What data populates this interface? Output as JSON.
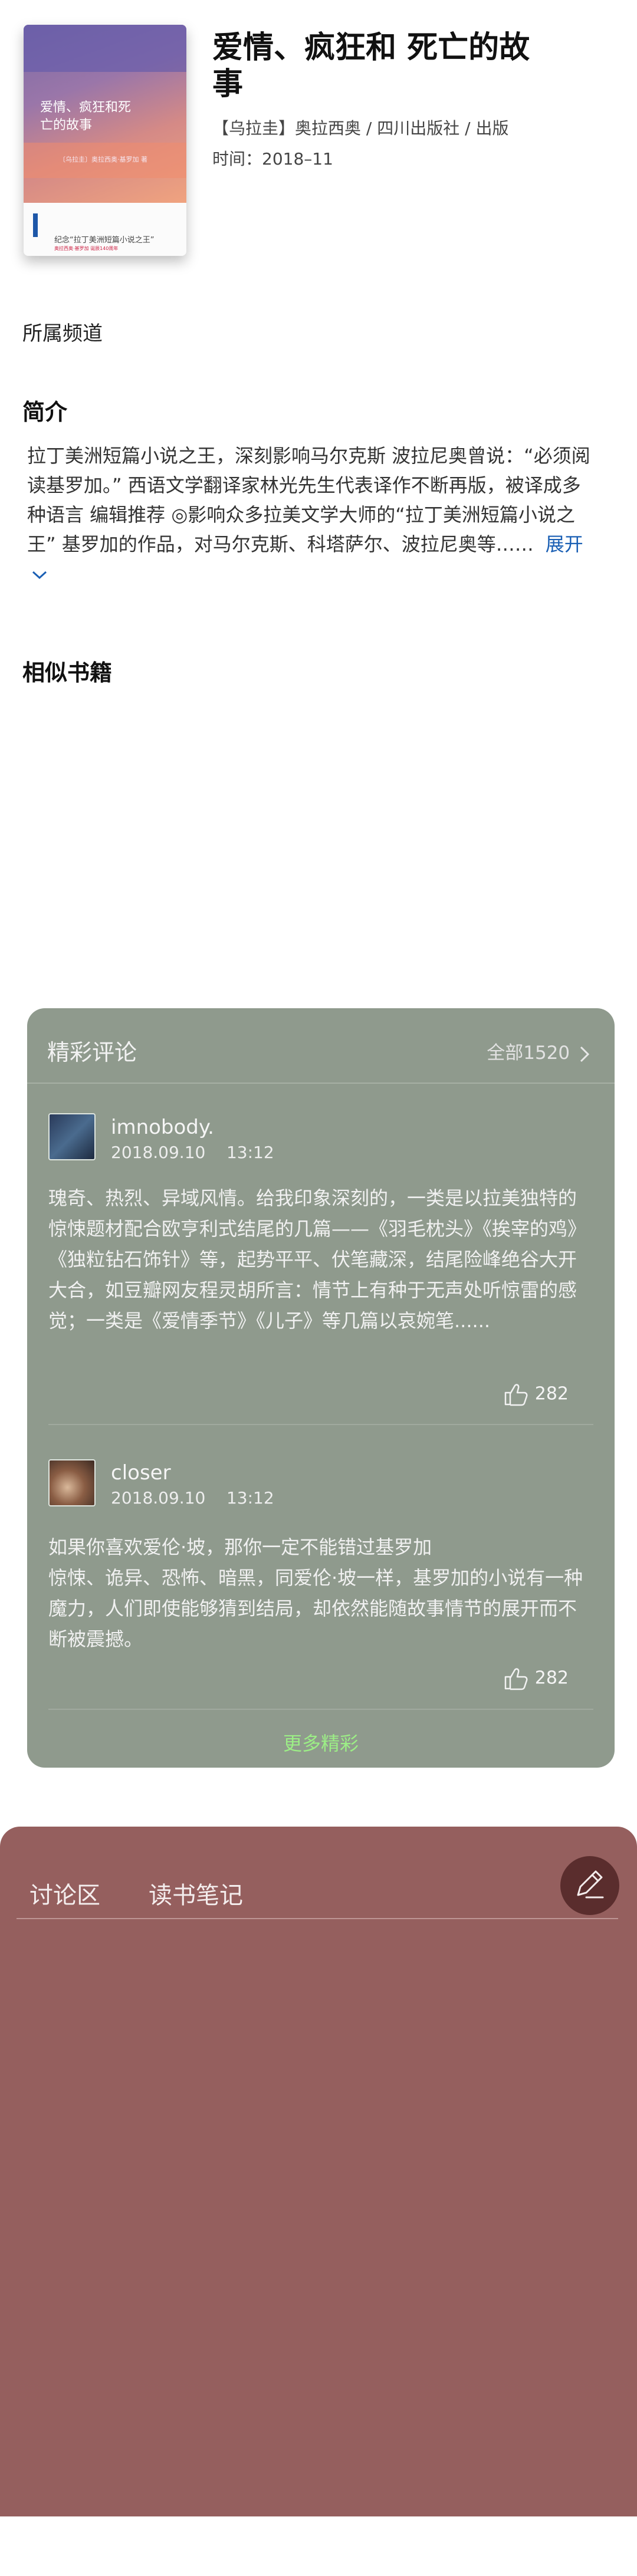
{
  "book": {
    "title": "爱情、疯狂和 死亡的故事",
    "authors_publisher": "【乌拉圭】奥拉西奥 / 四川出版社 / 出版",
    "time": "时间：2018–11",
    "cover": {
      "title": "爱情、疯狂和死亡的故事",
      "author": "〔乌拉圭〕奥拉西奥·基罗加 著",
      "tagline": "纪念“拉丁美洲短篇小说之王”",
      "sub": "奥拉西奥·基罗加 诞辰140周年"
    }
  },
  "channel": {
    "label": "所属频道"
  },
  "intro": {
    "heading": "简介",
    "text": "拉丁美洲短篇小说之王，深刻影响马尔克斯 波拉尼奥曾说：“必须阅读基罗加。” 西语文学翻译家林光先生代表译作不断再版，被译成多种语言 编辑推荐 ◎影响众多拉美文学大师的“拉丁美洲短篇小说之王” 基罗加的作品，对马尔克斯、科塔萨尔、波拉尼奥等……",
    "expand": "展开"
  },
  "similar": {
    "heading": "相似书籍"
  },
  "reviews": {
    "title": "精彩评论",
    "all_label": "全部1520",
    "more": "更多精彩",
    "items": [
      {
        "name": "imnobody.",
        "date": "2018.09.10",
        "time": "13:12",
        "text": "瑰奇、热烈、异域风情。给我印象深刻的，一类是以拉美独特的惊悚题材配合欧亨利式结尾的几篇——《羽毛枕头》《挨宰的鸡》《独粒钻石饰针》等，起势平平、伏笔藏深，结尾险峰绝谷大开大合，如豆瓣网友程灵胡所言：情节上有种于无声处听惊雷的感觉；一类是《爱情季节》《儿子》等几篇以哀婉笔......",
        "likes": "282"
      },
      {
        "name": "closer",
        "date": "2018.09.10",
        "time": "13:12",
        "text": "如果你喜欢爱伦·坡，那你一定不能错过基罗加\n惊悚、诡异、恐怖、暗黑，同爱伦·坡一样，基罗加的小说有一种魔力，人们即使能够猜到结局，却依然能随故事情节的展开而不断被震撼。",
        "likes": "282"
      }
    ]
  },
  "discussion": {
    "tabs": [
      "讨论区",
      "读书笔记"
    ]
  },
  "colors": {
    "card_bg": "#8f9a8d",
    "discussion_bg": "#955f5e",
    "expand_link": "#1a5fb4",
    "more_link": "#9cee86"
  },
  "icons": [
    "chevron-down-icon",
    "chevron-right-icon",
    "thumbs-up-icon",
    "edit-pen-icon"
  ]
}
